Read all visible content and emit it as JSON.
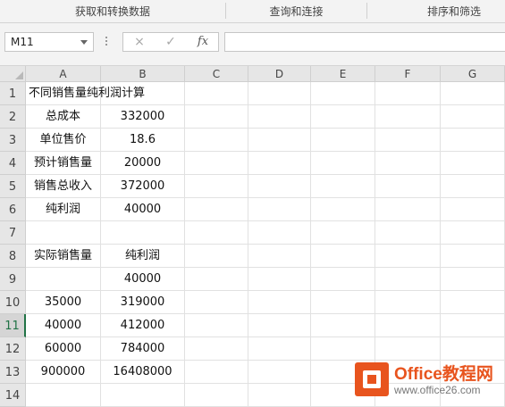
{
  "ribbon": {
    "groups": [
      "获取和转换数据",
      "查询和连接",
      "排序和筛选"
    ]
  },
  "formula_bar": {
    "name_box": "M11",
    "cancel_icon": "×",
    "enter_icon": "✓",
    "fx_label": "fx",
    "formula": ""
  },
  "sheet": {
    "columns": [
      "A",
      "B",
      "C",
      "D",
      "E",
      "F",
      "G"
    ],
    "rows": [
      "1",
      "2",
      "3",
      "4",
      "5",
      "6",
      "7",
      "8",
      "9",
      "10",
      "11",
      "12",
      "13",
      "14"
    ],
    "active_row": "11",
    "cells": {
      "r1": {
        "A": "不同销售量纯利润计算",
        "B": ""
      },
      "r2": {
        "A": "总成本",
        "B": "332000"
      },
      "r3": {
        "A": "单位售价",
        "B": "18.6"
      },
      "r4": {
        "A": "预计销售量",
        "B": "20000"
      },
      "r5": {
        "A": "销售总收入",
        "B": "372000"
      },
      "r6": {
        "A": "纯利润",
        "B": "40000"
      },
      "r7": {
        "A": "",
        "B": ""
      },
      "r8": {
        "A": "实际销售量",
        "B": "纯利润"
      },
      "r9": {
        "A": "",
        "B": "40000"
      },
      "r10": {
        "A": "35000",
        "B": "319000"
      },
      "r11": {
        "A": "40000",
        "B": "412000"
      },
      "r12": {
        "A": "60000",
        "B": "784000"
      },
      "r13": {
        "A": "900000",
        "B": "16408000"
      },
      "r14": {
        "A": "",
        "B": ""
      }
    }
  },
  "watermark": {
    "title": "Office教程网",
    "url": "www.office26.com",
    "accent": "#e8541e"
  },
  "colors": {
    "accent_green": "#217346",
    "header_bg": "#e6e6e6"
  }
}
